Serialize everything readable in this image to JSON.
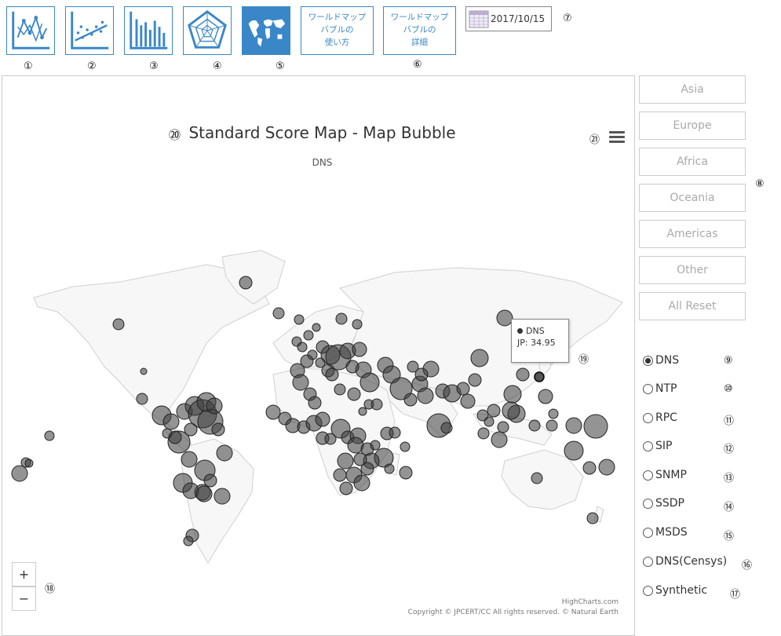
{
  "toolbar": {
    "buttons": [
      {
        "name": "line-chart-button",
        "icon": "line-chart-icon",
        "marker": "①"
      },
      {
        "name": "scatter-chart-button",
        "icon": "scatter-chart-icon",
        "marker": "②"
      },
      {
        "name": "bar-chart-button",
        "icon": "bar-chart-icon",
        "marker": "③"
      },
      {
        "name": "radar-chart-button",
        "icon": "radar-chart-icon",
        "marker": "④"
      },
      {
        "name": "world-map-button",
        "icon": "world-map-icon",
        "marker": "⑤"
      }
    ],
    "howto_label": "ワールドマップ\nバブルの\n使い方",
    "details_label": "ワールドマップ\nバブルの\n詳細",
    "details_marker": "⑥",
    "date_value": "2017/10/15",
    "date_marker": "⑦",
    "accent_color": "#3a87c8"
  },
  "chart": {
    "title_marker": "⑳",
    "title": "Standard Score Map - Map Bubble",
    "subtitle": "DNS",
    "menu_marker": "㉑",
    "tooltip_series": "DNS",
    "tooltip_value": "JP: 34.95",
    "tooltip_marker": "⑲",
    "zoom_in": "+",
    "zoom_out": "−",
    "zoom_marker": "⑱",
    "credits_site": "HighCharts.com",
    "credits_copy": "Copyright © JPCERT/CC All rights reserved. © Natural Earth"
  },
  "regions": {
    "marker": "⑧",
    "items": [
      "Asia",
      "Europe",
      "Africa",
      "Oceania",
      "Americas",
      "Other",
      "All Reset"
    ]
  },
  "datasets": {
    "selected": "DNS",
    "items": [
      {
        "label": "DNS",
        "marker": "⑨"
      },
      {
        "label": "NTP",
        "marker": "⑩"
      },
      {
        "label": "RPC",
        "marker": "⑪"
      },
      {
        "label": "SIP",
        "marker": "⑫"
      },
      {
        "label": "SNMP",
        "marker": "⑬"
      },
      {
        "label": "SSDP",
        "marker": "⑭"
      },
      {
        "label": "MSDS",
        "marker": "⑮"
      },
      {
        "label": "DNS(Censys)",
        "marker": "⑯"
      },
      {
        "label": "Synthetic",
        "marker": "⑰"
      }
    ]
  }
}
